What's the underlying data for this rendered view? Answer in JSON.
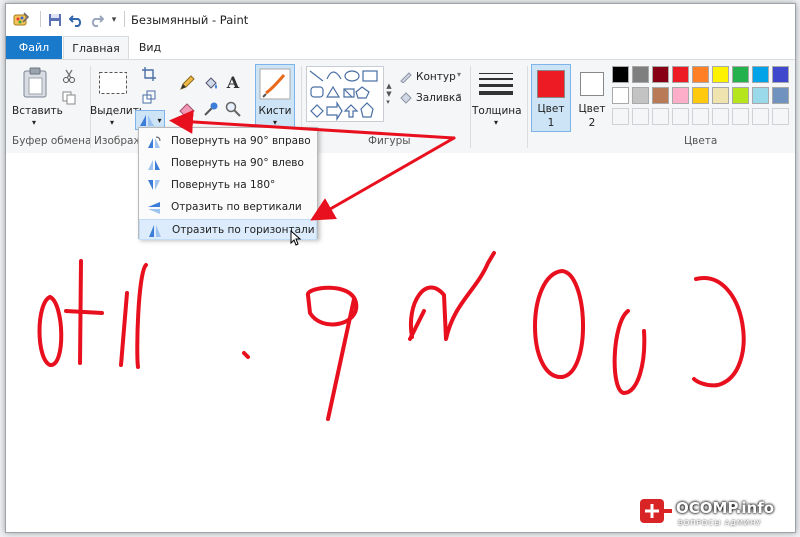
{
  "window": {
    "title": "Безымянный - Paint"
  },
  "quick_access": {
    "icons": [
      "paint-app-icon",
      "save-icon",
      "undo-icon",
      "redo-icon",
      "customize-quick-access-icon"
    ]
  },
  "tabs": [
    {
      "label": "Файл",
      "active": false
    },
    {
      "label": "Главная",
      "active": true
    },
    {
      "label": "Вид",
      "active": false
    }
  ],
  "ribbon": {
    "clipboard": {
      "paste_label": "Вставить",
      "group_label": "Буфер обмена"
    },
    "image": {
      "select_label": "Выделить",
      "group_label": "Изображ"
    },
    "brushes": {
      "label": "Кисти"
    },
    "shapes": {
      "outline_label": "Контур",
      "fill_label": "Заливка",
      "group_label": "Фигуры"
    },
    "size": {
      "label": "Толщина"
    },
    "colors": {
      "color1_label": "Цвет\n1",
      "color1_title": "Цвет",
      "color1_num": "1",
      "color2_title": "Цвет",
      "color2_num": "2",
      "group_label": "Цвета",
      "color1_value": "#ed1c24",
      "color2_value": "#ffffff",
      "palette_row1": [
        "#000000",
        "#7f7f7f",
        "#880015",
        "#ed1c24",
        "#ff7f27",
        "#fff200",
        "#22b14c",
        "#00a2e8",
        "#3f48cc"
      ],
      "palette_row2": [
        "#ffffff",
        "#c3c3c3",
        "#b97a57",
        "#ffaec9",
        "#ffc90e",
        "#efe4b0",
        "#b5e61d",
        "#99d9ea",
        "#7092be"
      ]
    }
  },
  "rotate_menu": {
    "items": [
      {
        "label": "Повернуть на 90° вправо"
      },
      {
        "label": "Повернуть на 90° влево"
      },
      {
        "label": "Повернуть на 180°"
      },
      {
        "label": "Отразить по вертикали"
      },
      {
        "label": "Отразить по горизонтали",
        "highlighted": true
      }
    ]
  },
  "canvas": {
    "ink_color": "#e8101e"
  },
  "watermark": {
    "brand": "OCOMP.info",
    "tagline": "ВОПРОСЫ АДМИНУ"
  },
  "annotation": {
    "arrow_color": "#e8101e"
  }
}
